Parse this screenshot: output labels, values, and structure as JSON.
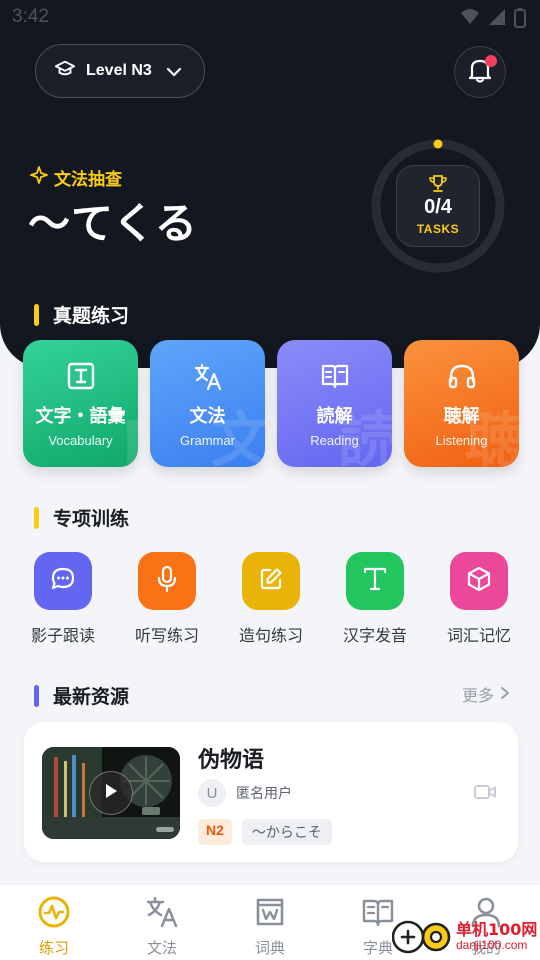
{
  "status_bar": {
    "time": "3:42"
  },
  "header": {
    "level_label": "Level N3",
    "grammar_tag": "文法抽查",
    "grammar_pattern": "～てくる",
    "tasks_count": "0/4",
    "tasks_label": "TASKS",
    "tasks_progress": 0
  },
  "sections": {
    "exam_practice": "真题练习",
    "special_training": "专项训练",
    "latest_resources": "最新资源",
    "more": "更多"
  },
  "practice_cards": [
    {
      "title": "文字・語彙",
      "subtitle": "Vocabulary",
      "icon": "text-box-icon",
      "color_from": "#34d399",
      "color_to": "#10a76a"
    },
    {
      "title": "文法",
      "subtitle": "Grammar",
      "icon": "translate-icon",
      "color_from": "#60a5fa",
      "color_to": "#3b7ff0"
    },
    {
      "title": "読解",
      "subtitle": "Reading",
      "icon": "open-book-icon",
      "color_from": "#8b8cf8",
      "color_to": "#6366f1"
    },
    {
      "title": "聴解",
      "subtitle": "Listening",
      "icon": "headphones-icon",
      "color_from": "#fb923c",
      "color_to": "#f06012"
    }
  ],
  "trainings": [
    {
      "label": "影子跟读",
      "icon": "chat-bubble-icon",
      "color": "#6366f1"
    },
    {
      "label": "听写练习",
      "icon": "microphone-icon",
      "color": "#f97316"
    },
    {
      "label": "造句练习",
      "icon": "edit-icon",
      "color": "#eab308"
    },
    {
      "label": "汉字发音",
      "icon": "letter-t-icon",
      "color": "#22c55e"
    },
    {
      "label": "词汇记忆",
      "icon": "cube-icon",
      "color": "#ec4899"
    }
  ],
  "resource": {
    "title": "伪物语",
    "avatar_initial": "U",
    "user": "匿名用户",
    "level_tag": "N2",
    "grammar_tag": "～からこそ"
  },
  "bottom_nav": [
    {
      "label": "练习",
      "icon": "activity-icon",
      "active": true
    },
    {
      "label": "文法",
      "icon": "translate-icon",
      "active": false
    },
    {
      "label": "词典",
      "icon": "dictionary-icon",
      "active": false
    },
    {
      "label": "字典",
      "icon": "book-icon",
      "active": false
    },
    {
      "label": "我的",
      "icon": "user-icon",
      "active": false
    }
  ],
  "watermark": {
    "text_cn": "单机100网",
    "text_url": "danji100.com"
  },
  "colors": {
    "accent_yellow": "#facc15",
    "dark_bg": "#13171f",
    "section_bar_yellow": "#facc15",
    "section_bar_indigo": "#6366f1"
  }
}
